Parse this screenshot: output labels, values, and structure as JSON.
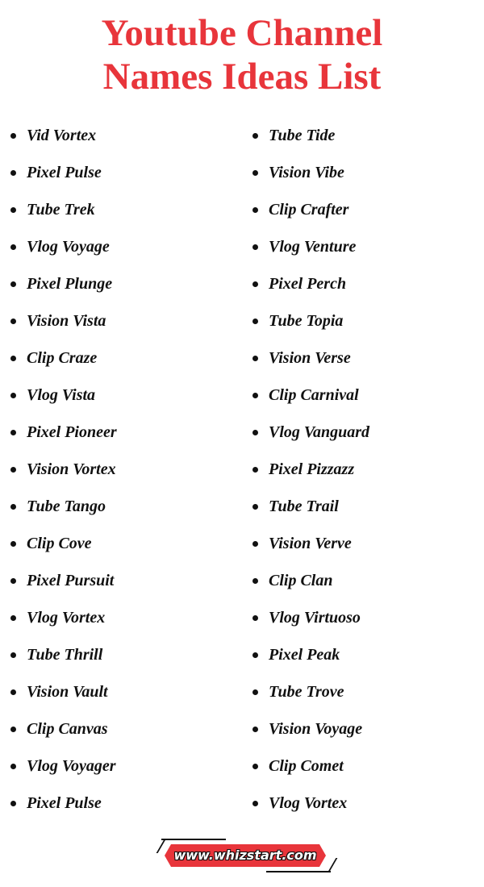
{
  "title": {
    "line1": "Youtube Channel",
    "line2": "Names Ideas List",
    "color": "#e8353b"
  },
  "left_column": [
    "Vid Vortex",
    "Pixel Pulse",
    "Tube Trek",
    "Vlog Voyage",
    "Pixel Plunge",
    "Vision Vista",
    "Clip Craze",
    "Vlog Vista",
    "Pixel Pioneer",
    "Vision Vortex",
    "Tube Tango",
    "Clip Cove",
    "Pixel Pursuit",
    "Vlog Vortex",
    "Tube Thrill",
    "Vision Vault",
    "Clip Canvas",
    "Vlog Voyager",
    "Pixel Pulse"
  ],
  "right_column": [
    "Tube Tide",
    "Vision Vibe",
    "Clip Crafter",
    "Vlog Venture",
    "Pixel Perch",
    "Tube Topia",
    "Vision Verse",
    "Clip Carnival",
    "Vlog Vanguard",
    "Pixel Pizzazz",
    "Tube Trail",
    "Vision Verve",
    "Clip Clan",
    "Vlog Virtuoso",
    "Pixel Peak",
    "Tube Trove",
    "Vision Voyage",
    "Clip Comet",
    "Vlog Vortex"
  ],
  "footer": {
    "website": "www.whizstart.com"
  }
}
